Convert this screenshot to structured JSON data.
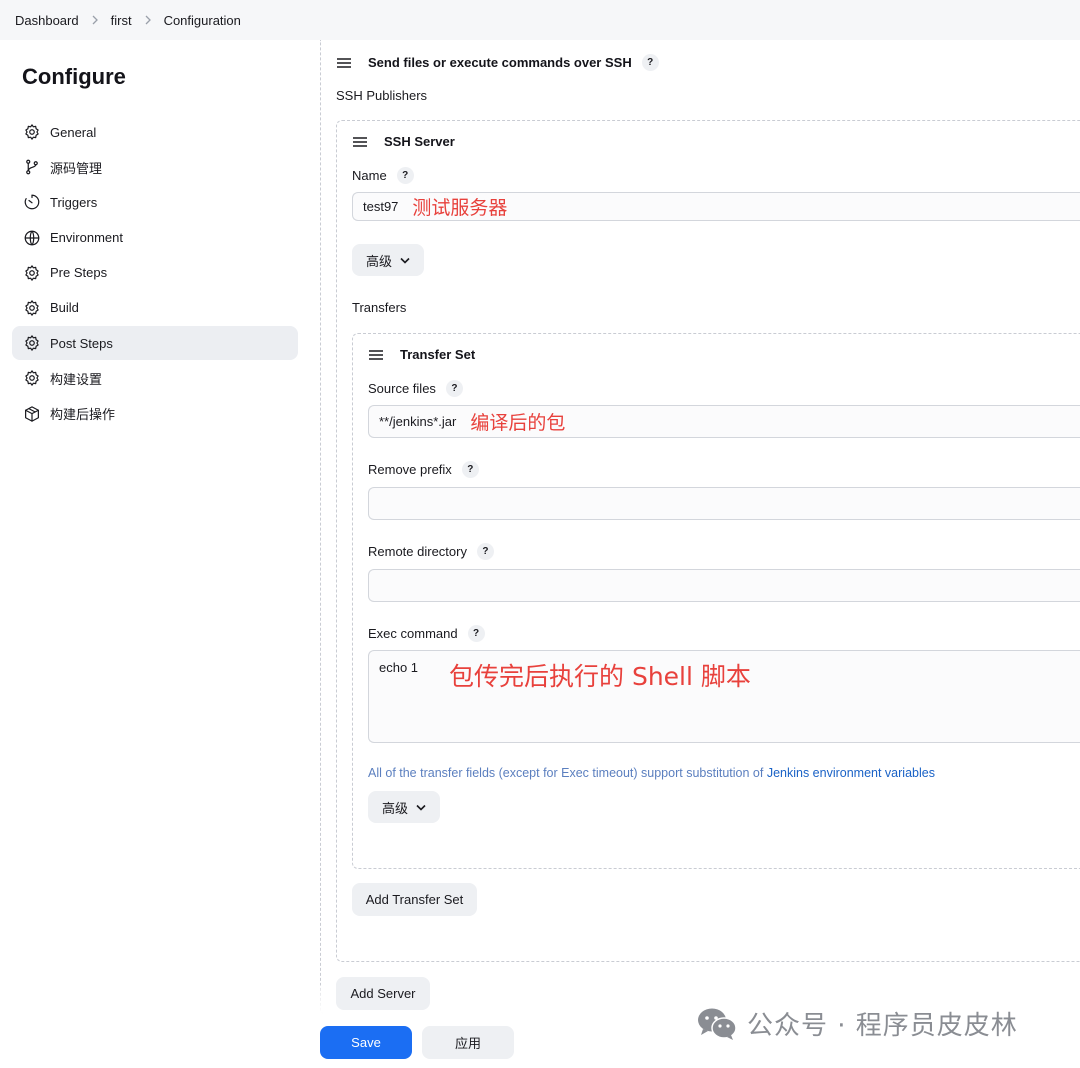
{
  "breadcrumb": [
    "Dashboard",
    "first",
    "Configuration"
  ],
  "page_title": "Configure",
  "sidebar": {
    "items": [
      {
        "label": "General",
        "icon": "gear-icon"
      },
      {
        "label": "源码管理",
        "icon": "branch-icon"
      },
      {
        "label": "Triggers",
        "icon": "clock-icon"
      },
      {
        "label": "Environment",
        "icon": "globe-icon"
      },
      {
        "label": "Pre Steps",
        "icon": "gear-icon"
      },
      {
        "label": "Build",
        "icon": "gear-icon"
      },
      {
        "label": "Post Steps",
        "icon": "gear-icon",
        "active": true
      },
      {
        "label": "构建设置",
        "icon": "gear-icon"
      },
      {
        "label": "构建后操作",
        "icon": "package-icon"
      }
    ]
  },
  "section": {
    "title": "Send files or execute commands over SSH",
    "help": "?",
    "publishers_label": "SSH Publishers"
  },
  "server": {
    "title": "SSH Server",
    "name_label": "Name",
    "name_value": "test97",
    "name_annotation": "测试服务器",
    "advanced_label": "高级",
    "transfers_label": "Transfers"
  },
  "transfer_set": {
    "title": "Transfer Set",
    "source_files_label": "Source files",
    "source_files_value": "**/jenkins*.jar",
    "source_files_annotation": "编译后的包",
    "remove_prefix_label": "Remove prefix",
    "remove_prefix_value": "",
    "remote_directory_label": "Remote directory",
    "remote_directory_value": "",
    "exec_command_label": "Exec command",
    "exec_command_value": "echo 1",
    "exec_command_annotation": "包传完后执行的 Shell 脚本",
    "hint_text": "All of the transfer fields (except for Exec timeout) support substitution of ",
    "hint_link": "Jenkins environment variables",
    "advanced_label": "高级"
  },
  "buttons": {
    "add_transfer_set": "Add Transfer Set",
    "add_server": "Add Server",
    "save": "Save",
    "apply": "应用"
  },
  "watermark": "公众号 · 程序员皮皮林",
  "colors": {
    "primary": "#1b6ef3",
    "annotation": "#e8413c",
    "link": "#1a62c6"
  }
}
